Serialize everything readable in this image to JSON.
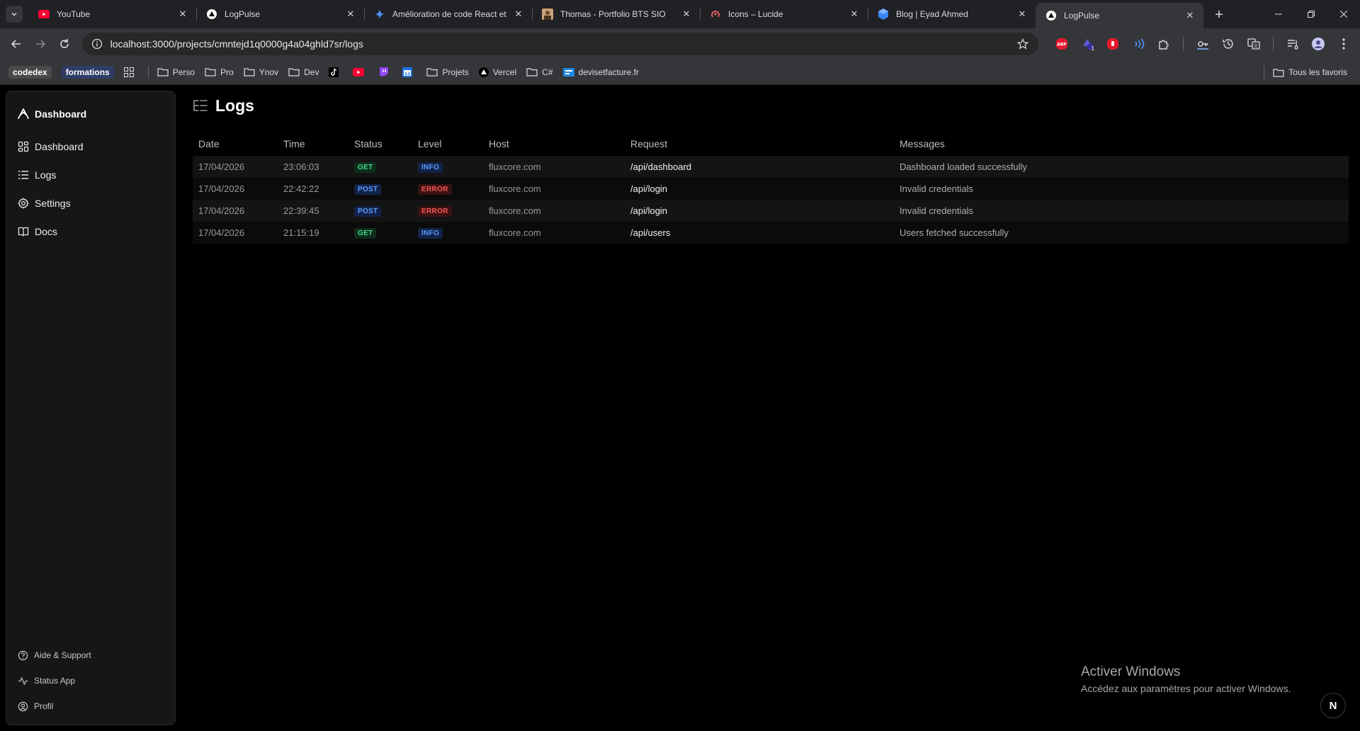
{
  "browser": {
    "tabs": [
      {
        "title": "YouTube",
        "icon": "youtube-icon",
        "active": false
      },
      {
        "title": "LogPulse",
        "icon": "triangle-icon",
        "active": false
      },
      {
        "title": "Amélioration de code React et",
        "icon": "sparkle-icon",
        "active": false
      },
      {
        "title": "Thomas - Portfolio BTS SIO",
        "icon": "portrait-icon",
        "active": false
      },
      {
        "title": "Icons – Lucide",
        "icon": "lucide-icon",
        "active": false
      },
      {
        "title": "Blog | Eyad Ahmed",
        "icon": "cube-icon",
        "active": false
      },
      {
        "title": "LogPulse",
        "icon": "triangle-icon",
        "active": true
      }
    ],
    "url": "localhost:3000/projects/cmntejd1q0000g4a04ghld7sr/logs",
    "bookmarks": [
      {
        "label": "codedex",
        "type": "chip"
      },
      {
        "label": "formations",
        "type": "chip-blue"
      },
      {
        "label": "",
        "type": "apps"
      },
      {
        "label": "Perso",
        "type": "folder"
      },
      {
        "label": "Pro",
        "type": "folder"
      },
      {
        "label": "Ynov",
        "type": "folder"
      },
      {
        "label": "Dev",
        "type": "folder"
      },
      {
        "label": "",
        "type": "tiktok"
      },
      {
        "label": "",
        "type": "youtube"
      },
      {
        "label": "",
        "type": "twitch"
      },
      {
        "label": "",
        "type": "calendar"
      },
      {
        "label": "Projets",
        "type": "folder"
      },
      {
        "label": "Vercel",
        "type": "vercel"
      },
      {
        "label": "C#",
        "type": "folder"
      },
      {
        "label": "devisetfacture.fr",
        "type": "site"
      }
    ],
    "bookmarks_right": "Tous les favoris",
    "extension_badge": "1"
  },
  "sidebar": {
    "brand": "Dashboard",
    "items": [
      {
        "label": "Dashboard",
        "icon": "layout-grid-icon"
      },
      {
        "label": "Logs",
        "icon": "list-icon"
      },
      {
        "label": "Settings",
        "icon": "settings-icon"
      },
      {
        "label": "Docs",
        "icon": "book-icon"
      }
    ],
    "bottom": [
      {
        "label": "Aide & Support",
        "icon": "help-circle-icon"
      },
      {
        "label": "Status App",
        "icon": "activity-icon"
      },
      {
        "label": "Profil",
        "icon": "user-circle-icon"
      }
    ]
  },
  "page": {
    "title": "Logs"
  },
  "table": {
    "columns": [
      "Date",
      "Time",
      "Status",
      "Level",
      "Host",
      "Request",
      "Messages"
    ],
    "rows": [
      {
        "date": "17/04/2026",
        "time": "23:06:03",
        "status": "GET",
        "level": "INFO",
        "host": "fluxcore.com",
        "request": "/api/dashboard",
        "message": "Dashboard loaded successfully"
      },
      {
        "date": "17/04/2026",
        "time": "22:42:22",
        "status": "POST",
        "level": "ERROR",
        "host": "fluxcore.com",
        "request": "/api/login",
        "message": "Invalid credentials"
      },
      {
        "date": "17/04/2026",
        "time": "22:39:45",
        "status": "POST",
        "level": "ERROR",
        "host": "fluxcore.com",
        "request": "/api/login",
        "message": "Invalid credentials"
      },
      {
        "date": "17/04/2026",
        "time": "21:15:19",
        "status": "GET",
        "level": "INFO",
        "host": "fluxcore.com",
        "request": "/api/users",
        "message": "Users fetched successfully"
      }
    ]
  },
  "watermark": {
    "title": "Activer Windows",
    "subtitle": "Accédez aux paramètres pour activer Windows."
  },
  "floating_button": "N",
  "colors": {
    "get": "#3ddc84",
    "post": "#5b9cff",
    "info": "#5b9cff",
    "error": "#ff5555",
    "sidebar_bg": "#161616"
  }
}
